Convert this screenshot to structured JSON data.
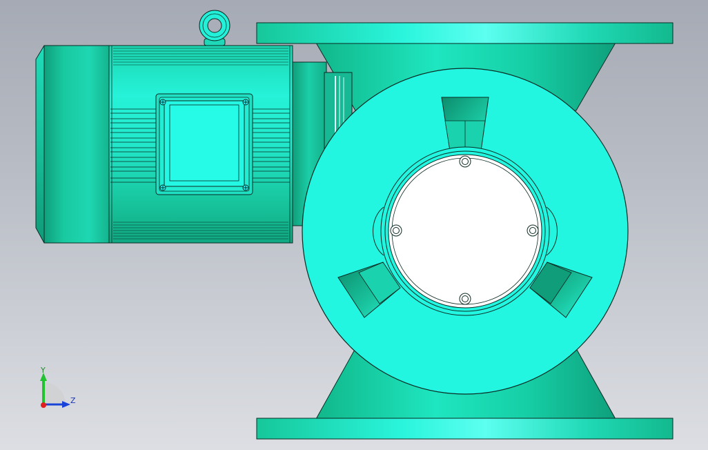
{
  "viewport": {
    "background_top": "#a5aab4",
    "background_bottom": "#dcdee3"
  },
  "model": {
    "name": "rotary-valve-with-motor",
    "colors": {
      "body_light": "#25f0d8",
      "body_mid": "#18cfa8",
      "body_dark": "#0e9b7c",
      "face_cyan": "#22f5e0",
      "outline": "#0a2a22",
      "cover_plate": "#ffffff"
    }
  },
  "triad": {
    "y_label": "Y",
    "z_label": "Z",
    "icon": "axis-triad-icon"
  }
}
